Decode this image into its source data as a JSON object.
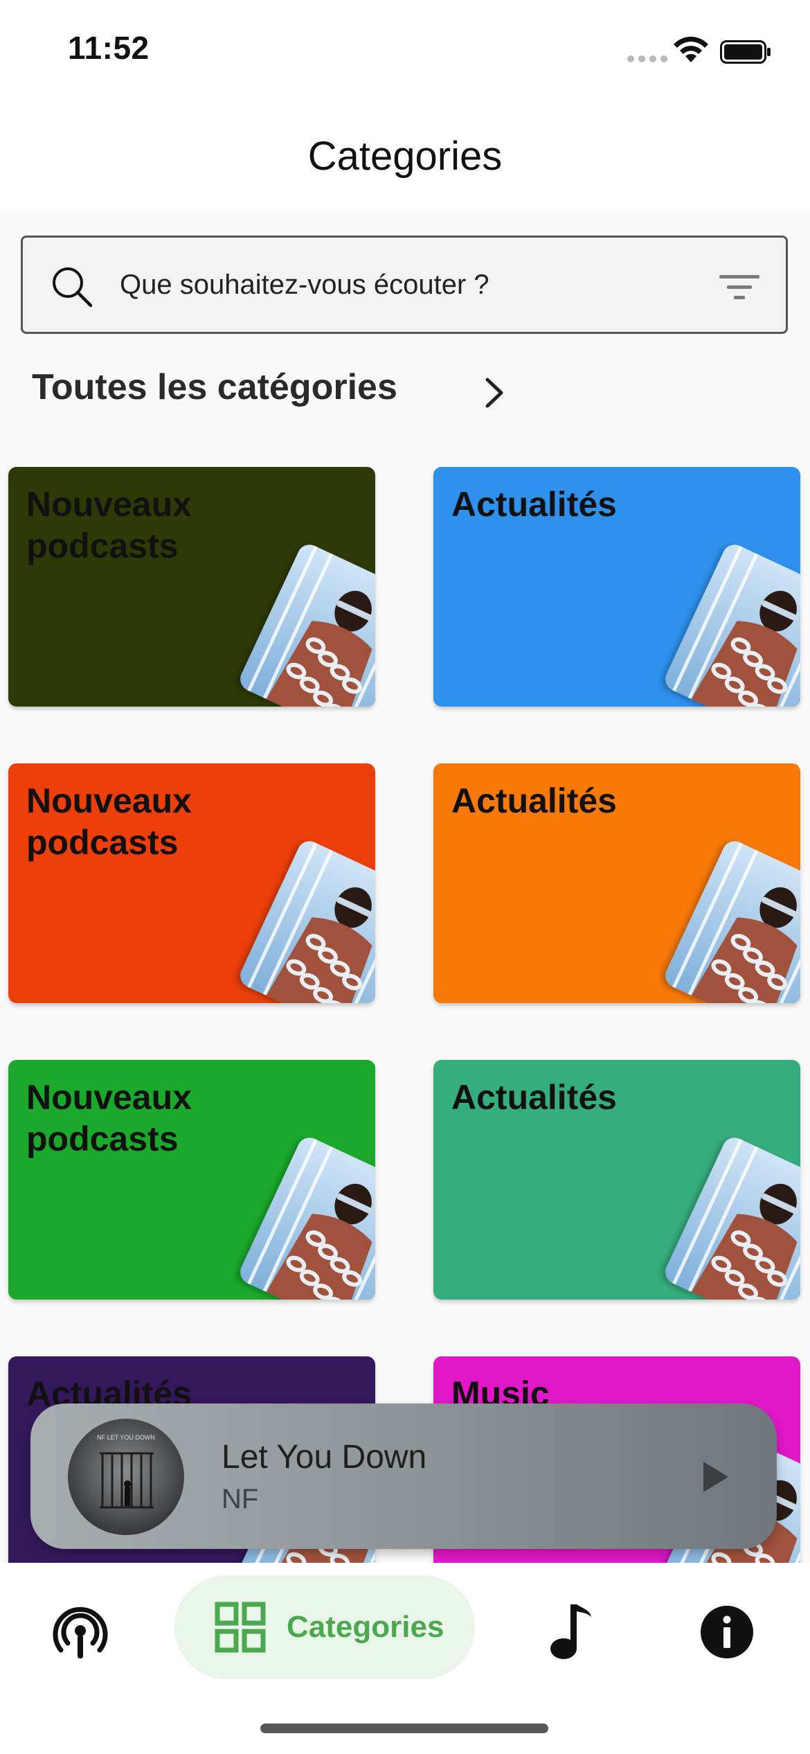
{
  "status_bar": {
    "time": "11:52"
  },
  "header": {
    "title": "Categories"
  },
  "search": {
    "placeholder": "Que souhaitez-vous écouter ?"
  },
  "section": {
    "title": "Toutes les catégories"
  },
  "categories": [
    {
      "label": "Nouveaux podcasts",
      "color": "#2e3a05"
    },
    {
      "label": "Actualités",
      "color": "#2e91ee"
    },
    {
      "label": "Nouveaux podcasts",
      "color": "#ec3f09"
    },
    {
      "label": "Actualités",
      "color": "#f87908"
    },
    {
      "label": "Nouveaux podcasts",
      "color": "#1aa92b"
    },
    {
      "label": "Actualités",
      "color": "#36ad7c"
    },
    {
      "label": "Actualités",
      "color": "#33195c"
    },
    {
      "label": "Music",
      "color": "#e218c8"
    }
  ],
  "mini_player": {
    "title": "Let You Down",
    "artist": "NF",
    "album_text": "NF LET YOU DOWN"
  },
  "bottom_nav": {
    "active": "categories",
    "items": [
      {
        "id": "podcasts",
        "icon": "podcast-icon"
      },
      {
        "id": "categories",
        "icon": "grid-icon",
        "label": "Categories"
      },
      {
        "id": "music",
        "icon": "music-note-icon"
      },
      {
        "id": "info",
        "icon": "info-icon"
      }
    ],
    "accent_color": "#4aa84e"
  }
}
